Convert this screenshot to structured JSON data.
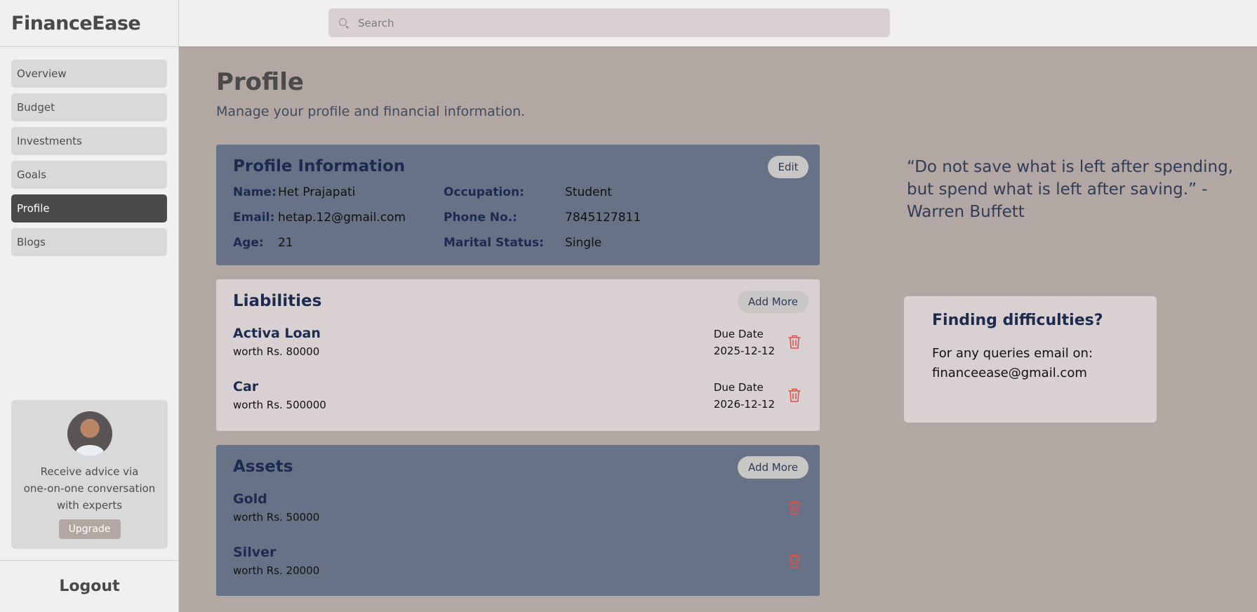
{
  "app": {
    "brand": "FinanceEase"
  },
  "search": {
    "placeholder": "Search"
  },
  "sidebar": {
    "items": [
      {
        "label": "Overview"
      },
      {
        "label": "Budget"
      },
      {
        "label": "Investments"
      },
      {
        "label": "Goals"
      },
      {
        "label": "Profile",
        "active": true
      },
      {
        "label": "Blogs"
      }
    ],
    "advice": {
      "text_line1": "Receive advice via",
      "text_line2": "one-on-one conversation",
      "text_line3": "with experts",
      "upgrade_label": "Upgrade"
    },
    "logout_label": "Logout"
  },
  "page": {
    "title": "Profile",
    "subtitle": "Manage your profile and financial information."
  },
  "profile_info": {
    "title": "Profile Information",
    "edit_label": "Edit",
    "fields": {
      "name_label": "Name:",
      "name_value": "Het Prajapati",
      "email_label": "Email:",
      "email_value": "hetap.12@gmail.com",
      "age_label": "Age:",
      "age_value": "21",
      "occupation_label": "Occupation:",
      "occupation_value": "Student",
      "phone_label": "Phone No.:",
      "phone_value": "7845127811",
      "marital_label": "Marital Status:",
      "marital_value": "Single"
    }
  },
  "liabilities": {
    "title": "Liabilities",
    "add_label": "Add More",
    "items": [
      {
        "name": "Activa Loan",
        "worth": "worth Rs. 80000",
        "due_label": "Due Date",
        "due_date": "2025-12-12"
      },
      {
        "name": "Car",
        "worth": "worth Rs. 500000",
        "due_label": "Due Date",
        "due_date": "2026-12-12"
      }
    ]
  },
  "assets": {
    "title": "Assets",
    "add_label": "Add More",
    "items": [
      {
        "name": "Gold",
        "worth": "worth Rs. 50000"
      },
      {
        "name": "Silver",
        "worth": "worth Rs. 20000"
      }
    ]
  },
  "quote": {
    "text": "“Do not save what is left after spending, but spend what is left after saving.” - Warren Buffett"
  },
  "help": {
    "title": "Finding difficulties?",
    "line1": "For any queries email on:",
    "line2": "financeease@gmail.com"
  },
  "colors": {
    "accent_dark": "#1c2b4f",
    "card_dark": "#687286",
    "card_light": "#d9d1d1",
    "trash": "#d9534f",
    "page_bg": "#b2a7a2"
  },
  "icons": {
    "search": "search-icon",
    "trash": "trash-icon"
  }
}
